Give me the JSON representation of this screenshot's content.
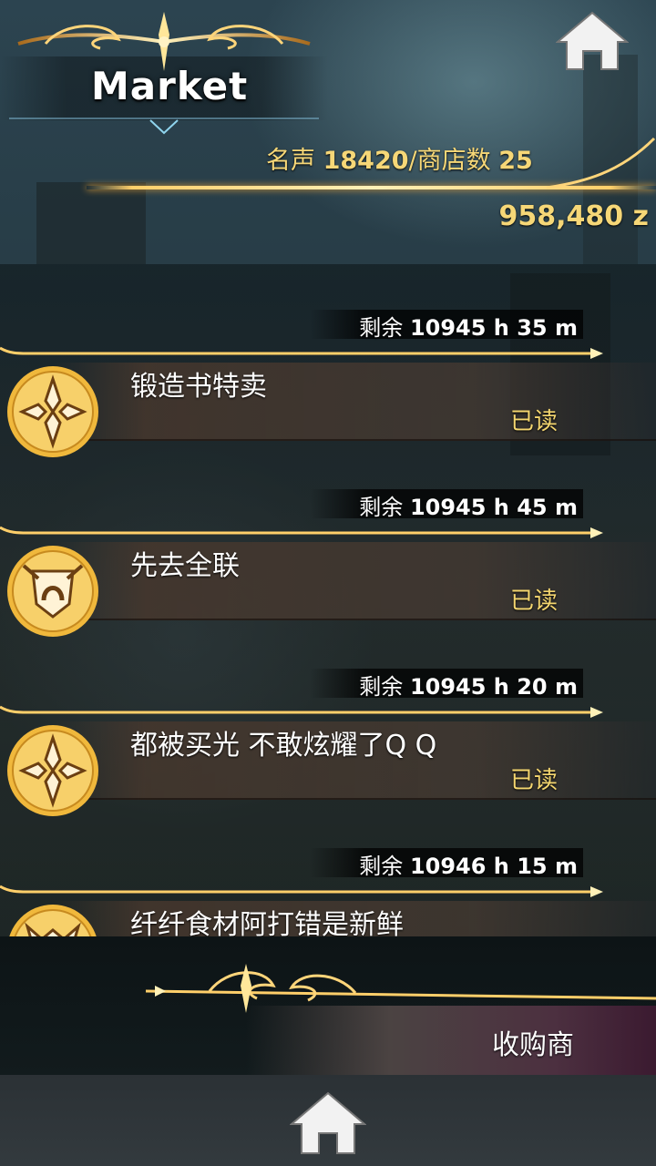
{
  "header": {
    "title": "Market",
    "home_icon": "home-icon"
  },
  "stats": {
    "reputation_label": "名声",
    "reputation_value": "18420",
    "shops_label": "/商店数",
    "shops_value": "25",
    "money": "958,480 z"
  },
  "messages": [
    {
      "remaining_label": "剩余",
      "remaining_value": "10945 h 35 m",
      "icon": "forge-emblem-icon",
      "title": "锻造书特卖",
      "status": "已读"
    },
    {
      "remaining_label": "剩余",
      "remaining_value": "10945 h 45 m",
      "icon": "smith-shield-icon",
      "title": "先去全联",
      "status": "已读"
    },
    {
      "remaining_label": "剩余",
      "remaining_value": "10945 h 20 m",
      "icon": "forge-emblem-icon",
      "title": "都被买光 不敢炫耀了Q Q",
      "status": "已读"
    },
    {
      "remaining_label": "剩余",
      "remaining_value": "10946 h 15 m",
      "icon": "food-emblem-icon",
      "title": "纤纤食材阿打错是新鲜",
      "status": ""
    }
  ],
  "bottom": {
    "buyer_tab_label": "收购商",
    "home_icon": "home-icon"
  },
  "colors": {
    "gold": "#f6d777",
    "gold_line": "#ffcf6a"
  }
}
